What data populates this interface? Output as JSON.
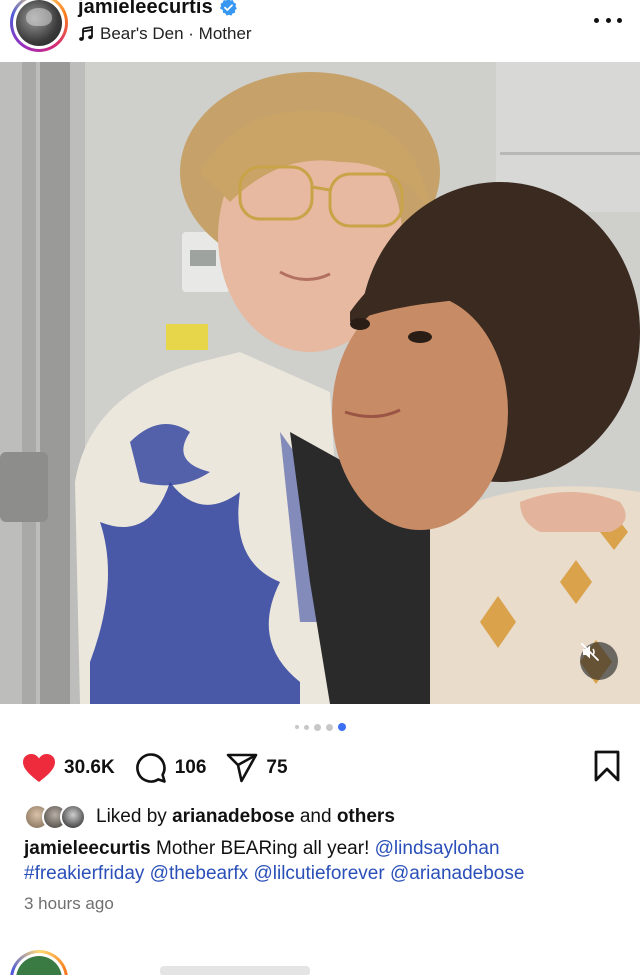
{
  "post": {
    "username": "jamieleecurtis",
    "audio": "Bear's Den · Mother",
    "icons": {
      "verified": "verified-badge-icon",
      "audio": "music-note-icon",
      "more": "more-options-icon",
      "mute": "muted-speaker-icon"
    }
  },
  "carousel": {
    "total_dots": 5,
    "active_index": 4
  },
  "actions": {
    "like_count": "30.6K",
    "comment_count": "106",
    "share_count": "75",
    "like_color": "#ed2b3c",
    "icons": [
      "heart-icon",
      "comment-icon",
      "send-icon",
      "bookmark-icon"
    ]
  },
  "likes": {
    "prefix": "Liked by",
    "user": "arianadebose",
    "conjunction": "and",
    "others": "others"
  },
  "caption": {
    "username": "jamieleecurtis",
    "text": "Mother BEARing all year!",
    "mention_1": "@lindsaylohan",
    "hashtag": "#freakierfriday",
    "mention_2": "@thebearfx",
    "mention_3": "@lilcutieforever",
    "mention_4": "@arianadebose"
  },
  "timestamp": "3 hours ago",
  "colors": {
    "link": "#2a4fb8",
    "carousel_active": "#3b6ef5",
    "verified": "#3897f0"
  }
}
